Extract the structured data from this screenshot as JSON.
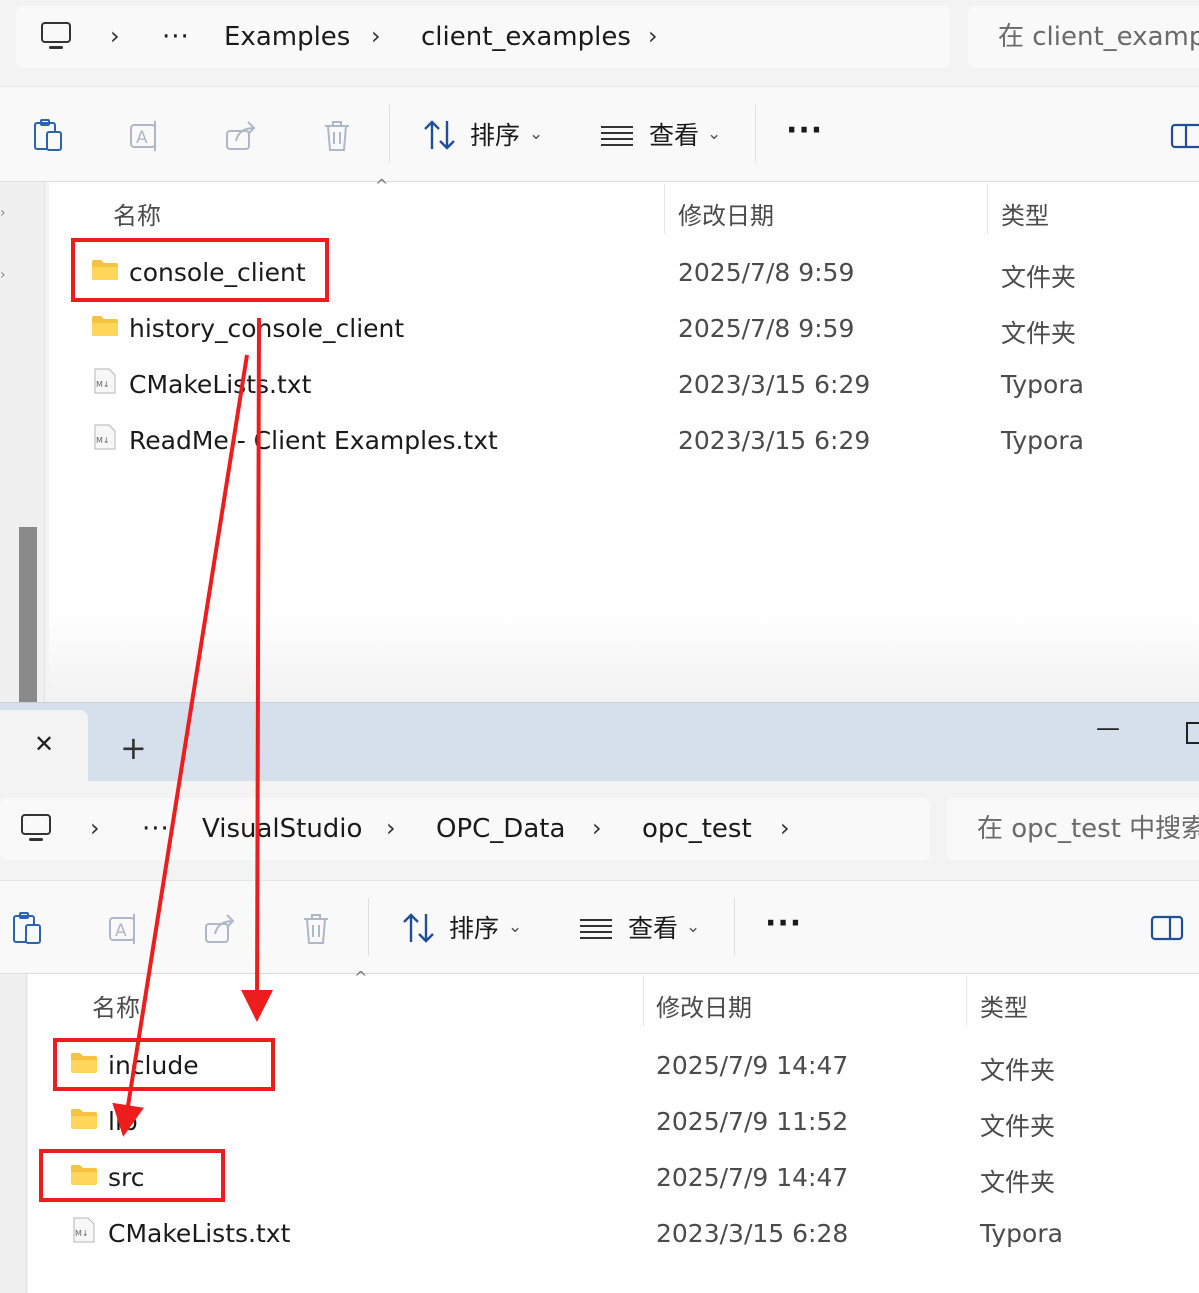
{
  "window1": {
    "address": {
      "segments": [
        "Examples",
        "client_examples"
      ],
      "ellipsis": "···"
    },
    "search_placeholder": "在 client_exampl",
    "toolbar": {
      "sort_label": "排序",
      "view_label": "查看",
      "more_label": "···"
    },
    "columns": {
      "name": "名称",
      "date": "修改日期",
      "type": "类型"
    },
    "files": [
      {
        "name": "console_client",
        "date": "2025/7/8 9:59",
        "type": "文件夹",
        "kind": "folder"
      },
      {
        "name": "history_console_client",
        "date": "2025/7/8 9:59",
        "type": "文件夹",
        "kind": "folder"
      },
      {
        "name": "CMakeLists.txt",
        "date": "2023/3/15 6:29",
        "type": "Typora",
        "kind": "markdown"
      },
      {
        "name": "ReadMe - Client Examples.txt",
        "date": "2023/3/15 6:29",
        "type": "Typora",
        "kind": "markdown"
      }
    ]
  },
  "window2": {
    "tab": {
      "close_glyph": "✕",
      "new_tab_glyph": "+"
    },
    "titlebar": {
      "minimize_glyph": "—"
    },
    "address": {
      "segments": [
        "VisualStudio",
        "OPC_Data",
        "opc_test"
      ],
      "ellipsis": "···"
    },
    "search_placeholder": "在 opc_test 中搜索",
    "toolbar": {
      "sort_label": "排序",
      "view_label": "查看",
      "more_label": "···"
    },
    "columns": {
      "name": "名称",
      "date": "修改日期",
      "type": "类型"
    },
    "files": [
      {
        "name": "include",
        "date": "2025/7/9 14:47",
        "type": "文件夹",
        "kind": "folder"
      },
      {
        "name": "lib",
        "date": "2025/7/9 11:52",
        "type": "文件夹",
        "kind": "folder"
      },
      {
        "name": "src",
        "date": "2025/7/9 14:47",
        "type": "文件夹",
        "kind": "folder"
      },
      {
        "name": "CMakeLists.txt",
        "date": "2023/3/15 6:28",
        "type": "Typora",
        "kind": "markdown"
      }
    ]
  },
  "annotations": {
    "highlight_color": "#ee1d1d",
    "arrows": [
      {
        "from": "console_client",
        "to": "include"
      },
      {
        "from": "history_console_client",
        "to": "src"
      }
    ]
  }
}
